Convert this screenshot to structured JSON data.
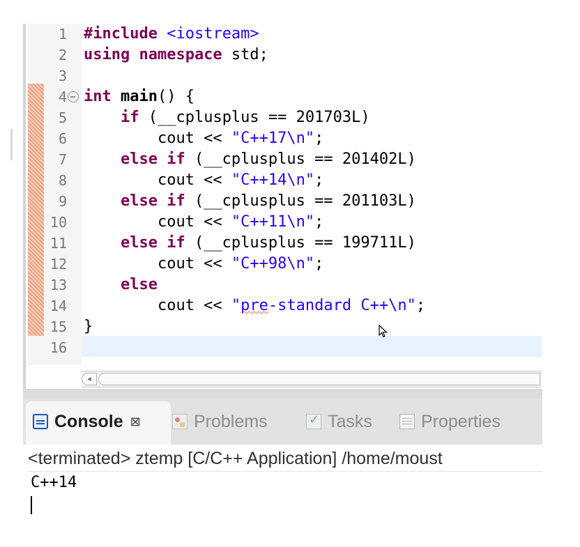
{
  "editor": {
    "lines": [
      {
        "n": "1",
        "segments": [
          {
            "t": "#include ",
            "c": "kw"
          },
          {
            "t": "<iostream>",
            "c": "inc"
          }
        ]
      },
      {
        "n": "2",
        "segments": [
          {
            "t": "using namespace ",
            "c": "kw"
          },
          {
            "t": "std;",
            "c": ""
          }
        ]
      },
      {
        "n": "3",
        "segments": []
      },
      {
        "n": "4",
        "segments": [
          {
            "t": "int ",
            "c": "kw"
          },
          {
            "t": "main",
            "c": "fn"
          },
          {
            "t": "() {",
            "c": ""
          }
        ]
      },
      {
        "n": "5",
        "segments": [
          {
            "t": "    ",
            "c": ""
          },
          {
            "t": "if",
            "c": "kw"
          },
          {
            "t": " (__cplusplus == 201703L)",
            "c": ""
          }
        ]
      },
      {
        "n": "6",
        "segments": [
          {
            "t": "        cout << ",
            "c": ""
          },
          {
            "t": "\"C++17\\n\"",
            "c": "str"
          },
          {
            "t": ";",
            "c": ""
          }
        ]
      },
      {
        "n": "7",
        "segments": [
          {
            "t": "    ",
            "c": ""
          },
          {
            "t": "else if",
            "c": "kw"
          },
          {
            "t": " (__cplusplus == 201402L)",
            "c": ""
          }
        ]
      },
      {
        "n": "8",
        "segments": [
          {
            "t": "        cout << ",
            "c": ""
          },
          {
            "t": "\"C++14\\n\"",
            "c": "str"
          },
          {
            "t": ";",
            "c": ""
          }
        ]
      },
      {
        "n": "9",
        "segments": [
          {
            "t": "    ",
            "c": ""
          },
          {
            "t": "else if",
            "c": "kw"
          },
          {
            "t": " (__cplusplus == 201103L)",
            "c": ""
          }
        ]
      },
      {
        "n": "10",
        "segments": [
          {
            "t": "        cout << ",
            "c": ""
          },
          {
            "t": "\"C++11\\n\"",
            "c": "str"
          },
          {
            "t": ";",
            "c": ""
          }
        ]
      },
      {
        "n": "11",
        "segments": [
          {
            "t": "    ",
            "c": ""
          },
          {
            "t": "else if",
            "c": "kw"
          },
          {
            "t": " (__cplusplus == 199711L)",
            "c": ""
          }
        ]
      },
      {
        "n": "12",
        "segments": [
          {
            "t": "        cout << ",
            "c": ""
          },
          {
            "t": "\"C++98\\n\"",
            "c": "str"
          },
          {
            "t": ";",
            "c": ""
          }
        ]
      },
      {
        "n": "13",
        "segments": [
          {
            "t": "    ",
            "c": ""
          },
          {
            "t": "else",
            "c": "kw"
          }
        ]
      },
      {
        "n": "14",
        "segments": [
          {
            "t": "        cout << ",
            "c": ""
          },
          {
            "t": "\"",
            "c": "str"
          },
          {
            "t": "pre",
            "c": "str squig"
          },
          {
            "t": "-standard C++\\n\"",
            "c": "str"
          },
          {
            "t": ";",
            "c": ""
          }
        ]
      },
      {
        "n": "15",
        "segments": [
          {
            "t": "}",
            "c": ""
          }
        ]
      },
      {
        "n": "16",
        "segments": []
      }
    ]
  },
  "tabs": {
    "console": "Console",
    "close": "⊠",
    "problems": "Problems",
    "tasks": "Tasks",
    "properties": "Properties"
  },
  "console": {
    "header": "<terminated> ztemp [C/C++ Application] /home/moust",
    "output": "C++14"
  }
}
